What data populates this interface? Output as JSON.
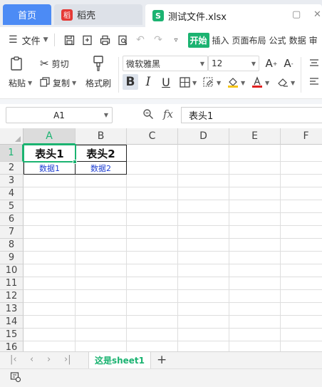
{
  "tabs": {
    "home": "首页",
    "daoke": "稻壳",
    "daoke_logo": "稻",
    "file": "测试文件.xlsx",
    "file_logo": "S"
  },
  "window_icons": {
    "restore": "▢",
    "grid": "⊞",
    "close": "✕"
  },
  "menubar": {
    "hamburger": "☰",
    "file_menu": "文件",
    "items": [
      "开始",
      "插入",
      "页面布局",
      "公式",
      "数据",
      "审"
    ]
  },
  "ribbon": {
    "paste": "粘贴",
    "cut": "剪切",
    "copy": "复制",
    "format_painter": "格式刷",
    "font_name": "微软雅黑",
    "font_size": "12",
    "bold": "B",
    "italic": "I",
    "underline": "U"
  },
  "formula_bar": {
    "name_box": "A1",
    "fx": "fx",
    "content": "表头1"
  },
  "grid": {
    "columns": [
      "A",
      "B",
      "C",
      "D",
      "E",
      "F"
    ],
    "rows": [
      "1",
      "2",
      "3",
      "4",
      "5",
      "6",
      "7",
      "8",
      "9",
      "10",
      "11",
      "12",
      "13",
      "14",
      "15",
      "16"
    ],
    "cells": {
      "A1": "表头1",
      "B1": "表头2",
      "A2": "数据1",
      "B2": "数据2"
    }
  },
  "sheets": {
    "active": "这是sheet1",
    "add": "+"
  },
  "colors": {
    "accent": "#1bb371",
    "home_tab": "#4c8bf5",
    "data_text": "#1f3fd1"
  }
}
